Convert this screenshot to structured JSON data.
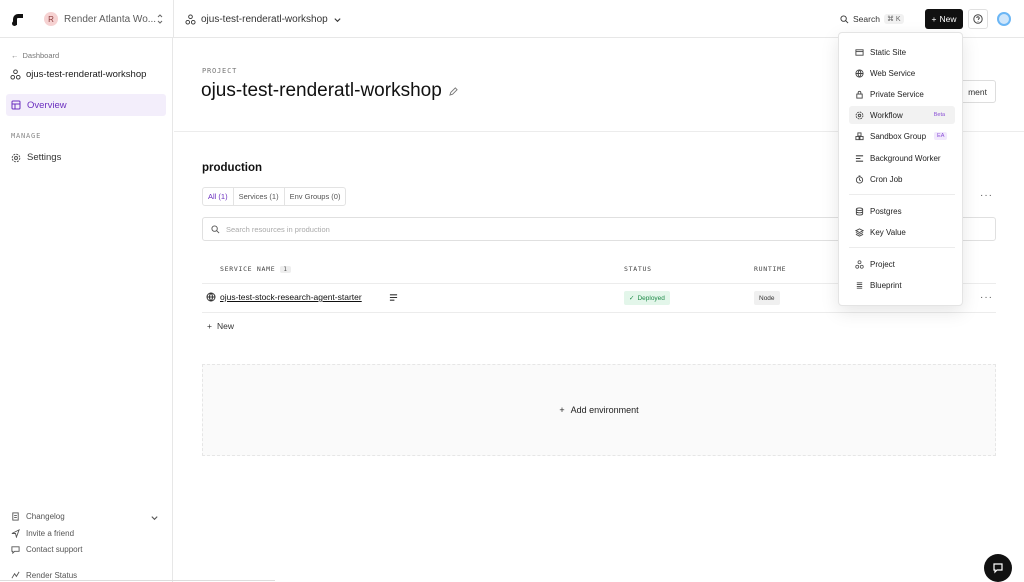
{
  "topbar": {
    "workspace_initial": "R",
    "workspace_name": "Render Atlanta Wo...",
    "project_name": "ojus-test-renderatl-workshop",
    "search_label": "Search",
    "search_shortcut": "⌘ K",
    "new_label": "New"
  },
  "sidebar": {
    "back_label": "Dashboard",
    "project_name": "ojus-test-renderatl-workshop",
    "overview_label": "Overview",
    "manage_heading": "MANAGE",
    "settings_label": "Settings",
    "footer": {
      "changelog": "Changelog",
      "invite": "Invite a friend",
      "support": "Contact support",
      "status": "Render Status"
    }
  },
  "main": {
    "project_label": "PROJECT",
    "project_title": "ojus-test-renderatl-workshop",
    "header_button_label": "ment",
    "environment_name": "production",
    "filters": [
      {
        "label": "All (1)",
        "active": true
      },
      {
        "label": "Services (1)",
        "active": false
      },
      {
        "label": "Env Groups (0)",
        "active": false
      }
    ],
    "search_placeholder": "Search resources in production",
    "table": {
      "headers": {
        "service_name": "SERVICE NAME",
        "count": "1",
        "status": "STATUS",
        "runtime": "RUNTIME"
      },
      "rows": [
        {
          "name": "ojus-test-stock-research-agent-starter",
          "status": "Deployed",
          "runtime": "Node"
        }
      ]
    },
    "new_label": "New",
    "add_environment_label": "Add environment"
  },
  "new_menu": {
    "items": [
      {
        "label": "Static Site",
        "icon": "static-site-icon",
        "tag": ""
      },
      {
        "label": "Web Service",
        "icon": "globe-icon",
        "tag": ""
      },
      {
        "label": "Private Service",
        "icon": "lock-icon",
        "tag": ""
      },
      {
        "label": "Workflow",
        "icon": "workflow-icon",
        "tag": "Beta"
      },
      {
        "label": "Sandbox Group",
        "icon": "sandbox-icon",
        "tag": "EA"
      },
      {
        "label": "Background Worker",
        "icon": "worker-icon",
        "tag": ""
      },
      {
        "label": "Cron Job",
        "icon": "clock-icon",
        "tag": ""
      },
      {
        "label": "Postgres",
        "icon": "database-icon",
        "tag": ""
      },
      {
        "label": "Key Value",
        "icon": "layers-icon",
        "tag": ""
      },
      {
        "label": "Project",
        "icon": "project-icon",
        "tag": ""
      },
      {
        "label": "Blueprint",
        "icon": "blueprint-icon",
        "tag": ""
      }
    ],
    "hovered_item": "Workflow"
  },
  "colors": {
    "accent": "#6b2fbf",
    "accent_bg": "#f3eefb",
    "deployed_bg": "#e3f6ea",
    "deployed_text": "#1e8a48",
    "primary_button": "#111111"
  }
}
